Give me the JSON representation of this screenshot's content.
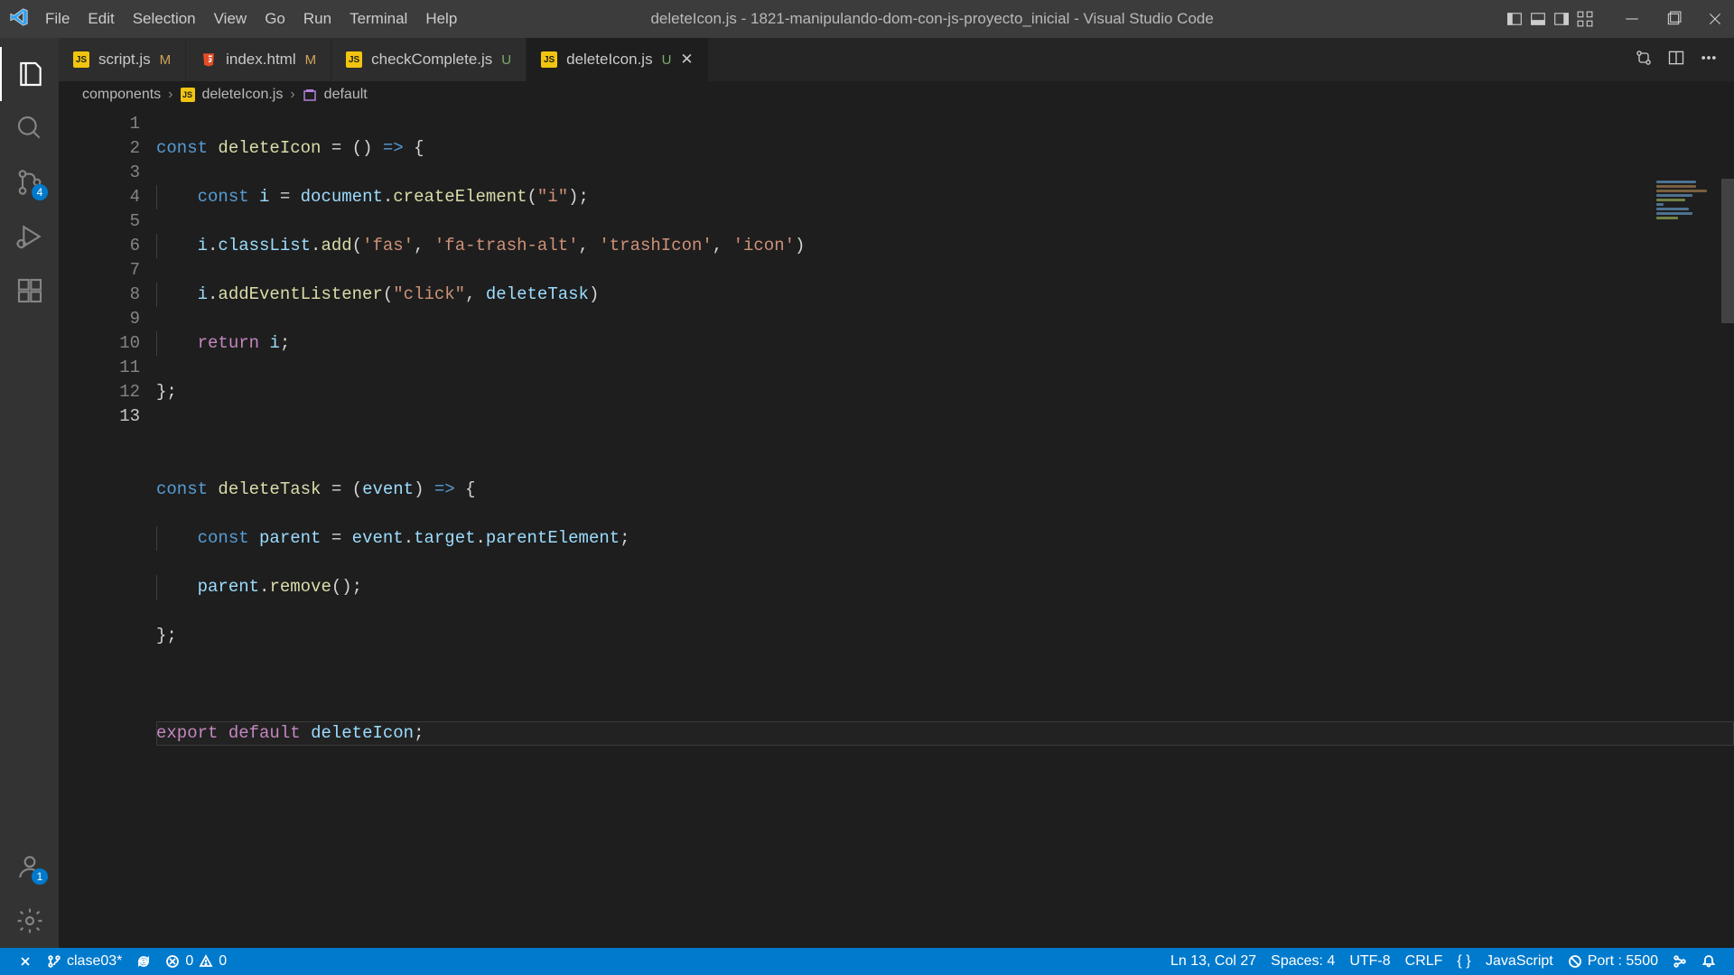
{
  "titlebar": {
    "menu": [
      "File",
      "Edit",
      "Selection",
      "View",
      "Go",
      "Run",
      "Terminal",
      "Help"
    ],
    "title": "deleteIcon.js - 1821-manipulando-dom-con-js-proyecto_inicial - Visual Studio Code"
  },
  "activitybar": {
    "scm_badge": "4",
    "accounts_badge": "1"
  },
  "tabs": [
    {
      "icon": "js",
      "label": "script.js",
      "status": "M",
      "active": false
    },
    {
      "icon": "html",
      "label": "index.html",
      "status": "M",
      "active": false
    },
    {
      "icon": "js",
      "label": "checkComplete.js",
      "status": "U",
      "active": false
    },
    {
      "icon": "js",
      "label": "deleteIcon.js",
      "status": "U",
      "active": true
    }
  ],
  "breadcrumb": {
    "folder": "components",
    "file": "deleteIcon.js",
    "symbol": "default"
  },
  "code": {
    "active_line": 13,
    "lines": 13
  },
  "statusbar": {
    "branch": "clase03*",
    "errors": "0",
    "warnings": "0",
    "position": "Ln 13, Col 27",
    "spaces": "Spaces: 4",
    "encoding": "UTF-8",
    "eol": "CRLF",
    "language": "JavaScript",
    "port": "Port : 5500"
  }
}
